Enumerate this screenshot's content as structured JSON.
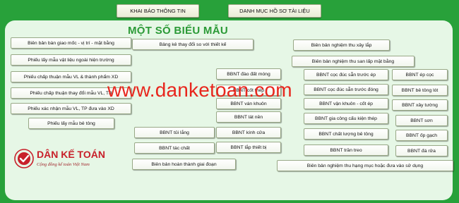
{
  "tabs": {
    "templates": "KHAI BÁO THÔNG TIN",
    "docs_list": "DANH MỤC HỒ SƠ TÀI LIỆU"
  },
  "title": "MỘT SỐ BIỂU MẪU",
  "buttons": [
    "Biên bản bàn giao mốc - vị trí - mặt bằng",
    "Phiếu lấy mẫu vật liệu ngoài hiện trường",
    "Phiếu chấp thuận mẫu VL & thành phẩm XD",
    "Phiếu chấp thuận thay đổi mẫu VL, TB",
    "Phiếu xác nhận mẫu VL, TP đưa vào XD",
    "Phiếu lấy mẫu bê tông",
    "Bảng kê thay đổi so với thiết kế",
    "BBNT đào đất móng",
    "BBNT cốt thép",
    "BBNT ván khuôn",
    "BBNT lát nền",
    "BBNT kính cửa",
    "BBNT lắp thiết bị",
    "BBNT tủi lắng",
    "BBNT tác chất",
    "Biên bản hoàn thành giai đoạn",
    "Biên bản nghiệm thu xây lắp",
    "Biên bản nghiệm thu san lấp mặt bằng",
    "BBNT cọc đúc sẵn trước ép",
    "BBNT cọc đúc sẵn trước đóng",
    "BBNT vận khuôn - cốt ép",
    "BBNT gia công cấu kiện thép",
    "BBNT chất lượng bê tông",
    "BBNT trần treo",
    "Biên bản nghiệm thu hạng mục hoặc đưa vào sử dụng",
    "BBNT ép cọc",
    "BBNT bê tông lót",
    "BBNT xây tường",
    "BBNT sơn",
    "BBNT ốp gạch",
    "BBNT đá rửa"
  ],
  "watermark": "www.danketoan.com",
  "logo": {
    "name": "DÂN KẾ TOÁN",
    "slogan": "Cộng đồng kế toán Việt Nam"
  },
  "colors": {
    "background": "#28a13a",
    "panel": "#e6f7e6",
    "title": "#2b9a36",
    "watermark": "#e8261d",
    "logo": "#c8202a"
  }
}
